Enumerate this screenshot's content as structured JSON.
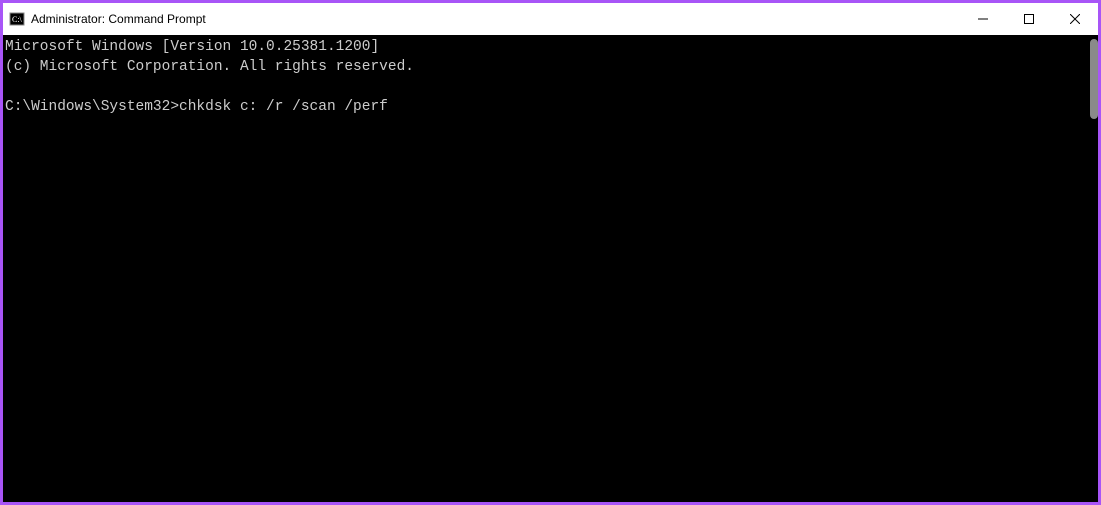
{
  "window": {
    "title": "Administrator: Command Prompt"
  },
  "terminal": {
    "line1": "Microsoft Windows [Version 10.0.25381.1200]",
    "line2": "(c) Microsoft Corporation. All rights reserved.",
    "blank": "",
    "prompt": "C:\\Windows\\System32>",
    "command": "chkdsk c: /r /scan /perf"
  }
}
